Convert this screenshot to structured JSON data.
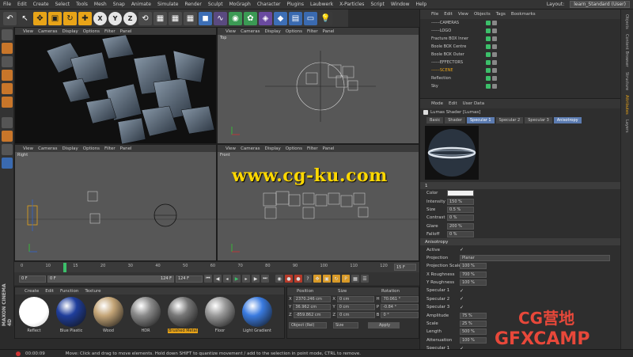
{
  "menu": {
    "items": [
      "File",
      "Edit",
      "Create",
      "Select",
      "Tools",
      "Mesh",
      "Snap",
      "Animate",
      "Simulate",
      "Render",
      "Sculpt",
      "MoGraph",
      "Character",
      "Plugins",
      "Laubwerk",
      "X-Particles",
      "Script",
      "Window",
      "Help"
    ],
    "layout_label": "Layout:",
    "layout_value": "learn_Standard (User)"
  },
  "toolbar": {
    "icons": [
      "undo-icon",
      "move-icon",
      "scale-icon",
      "rotate-icon",
      "select-icon",
      "axis-x-icon",
      "axis-y-icon",
      "axis-z-icon",
      "coord-system-icon",
      "render-view-icon",
      "render-picture-icon",
      "render-settings-icon",
      "cube-icon",
      "spline-icon",
      "nurbs-icon",
      "array-icon",
      "deformer-icon",
      "scene-icon",
      "camera-icon",
      "light-icon"
    ]
  },
  "viewports": {
    "menu": [
      "View",
      "Cameras",
      "Display",
      "Options",
      "Filter",
      "Panel"
    ],
    "perspective_label": "",
    "top_label": "Top",
    "right_label": "Right",
    "front_label": "Front"
  },
  "watermark": "www.cg-ku.com",
  "timeline": {
    "ticks": [
      "0",
      "10",
      "15",
      "20",
      "30",
      "40",
      "50",
      "60",
      "70",
      "80",
      "90",
      "100",
      "110",
      "120"
    ],
    "current_frame": "15 F"
  },
  "transport": {
    "start_field": "0 F",
    "current_field": "0 F",
    "end_field": "124 F",
    "max_field": "124 F"
  },
  "materials": {
    "menu": [
      "Create",
      "Edit",
      "Function",
      "Texture"
    ],
    "items": [
      {
        "name": "Reflect",
        "color": "#ffffff"
      },
      {
        "name": "Blue Plastic",
        "color": "#1f3e9c"
      },
      {
        "name": "Wood",
        "color": "#c4a577"
      },
      {
        "name": "HDR",
        "color": "#8a8a8a"
      },
      {
        "name": "Brushed Metal",
        "color": "#777777"
      },
      {
        "name": "Floor",
        "color": "#999999"
      },
      {
        "name": "Light Gradient",
        "color": "#3a7be0"
      }
    ],
    "selected": "Brushed Metal"
  },
  "coordinates": {
    "headers": [
      "Position",
      "Size",
      "Rotation"
    ],
    "rows": [
      {
        "axis": "X",
        "pos": "2370.246 cm",
        "size": "0 cm",
        "rot_label": "H",
        "rot": "70.061 °"
      },
      {
        "axis": "Y",
        "pos": "36.962 cm",
        "size": "0 cm",
        "rot_label": "P",
        "rot": "-0.84 °"
      },
      {
        "axis": "Z",
        "pos": "-859.862 cm",
        "size": "0 cm",
        "rot_label": "B",
        "rot": "0 °"
      }
    ],
    "mode": "Object (Rel)",
    "size_mode": "Size",
    "apply_label": "Apply"
  },
  "status": {
    "time": "00:00:09",
    "message": "Move: Click and drag to move elements. Hold down SHIFT to quantize movement / add to the selection in point mode, CTRL to remove."
  },
  "object_manager": {
    "menu": [
      "File",
      "Edit",
      "View",
      "Objects",
      "Tags",
      "Bookmarks"
    ],
    "rows": [
      {
        "name": "------CAMERAS",
        "color": "#c8c8c8"
      },
      {
        "name": "------LOGO",
        "color": "#c8c8c8"
      },
      {
        "name": "Fracture BOX Inner",
        "color": "#c8c8c8"
      },
      {
        "name": "Boole BOX Centre",
        "color": "#c8c8c8"
      },
      {
        "name": "Boole BOX Outer",
        "color": "#c8c8c8"
      },
      {
        "name": "------EFFECTORS",
        "color": "#c8c8c8"
      },
      {
        "name": "------SCENE",
        "color": "#e8a418"
      },
      {
        "name": "Reflection",
        "color": "#c8c8c8"
      },
      {
        "name": "Sky",
        "color": "#c8c8c8"
      }
    ]
  },
  "attributes": {
    "menu": [
      "Mode",
      "Edit",
      "User Data"
    ],
    "title": "Lumas Shader [Lumas]",
    "tabs": [
      "Basic",
      "Shader",
      "Specular 1",
      "Specular 2",
      "Specular 3",
      "Anisotropy"
    ],
    "active_tabs": [
      "Specular 1",
      "Anisotropy"
    ],
    "section_label": "1",
    "specular": [
      {
        "label": "Color",
        "value": ""
      },
      {
        "label": "Intensity",
        "value": "150 %"
      },
      {
        "label": "Size",
        "value": "0.5 %"
      },
      {
        "label": "Contrast",
        "value": "0 %"
      },
      {
        "label": "Glare",
        "value": "200 %"
      },
      {
        "label": "Falloff",
        "value": "0 %"
      }
    ],
    "anisotropy_title": "Anisotropy",
    "anisotropy": [
      {
        "label": "Active",
        "type": "check"
      },
      {
        "label": "Projection",
        "type": "select",
        "value": "Planar"
      },
      {
        "label": "Projection Scale",
        "type": "value",
        "value": "100 %"
      },
      {
        "label": "X Roughness",
        "type": "value",
        "value": "700 %"
      },
      {
        "label": "Y Roughness",
        "type": "value",
        "value": "100 %"
      },
      {
        "label": "Specular 1",
        "type": "check"
      },
      {
        "label": "Specular 2",
        "type": "check"
      },
      {
        "label": "Specular 3",
        "type": "check"
      },
      {
        "label": "Amplitude",
        "type": "value",
        "value": "75 %"
      },
      {
        "label": "Scale",
        "type": "value",
        "value": "25 %"
      },
      {
        "label": "Length",
        "type": "value",
        "value": "500 %"
      },
      {
        "label": "Attenuation",
        "type": "value",
        "value": "100 %"
      },
      {
        "label": "Specular 1",
        "type": "check"
      }
    ]
  },
  "right_tabs": [
    "Objects",
    "Content Browser",
    "Structure",
    "Attributes",
    "Layers"
  ],
  "logo": {
    "line1": "CG营地",
    "line2": "GFXCAMP"
  },
  "left_brand": "MAXON CINEMA 4D"
}
